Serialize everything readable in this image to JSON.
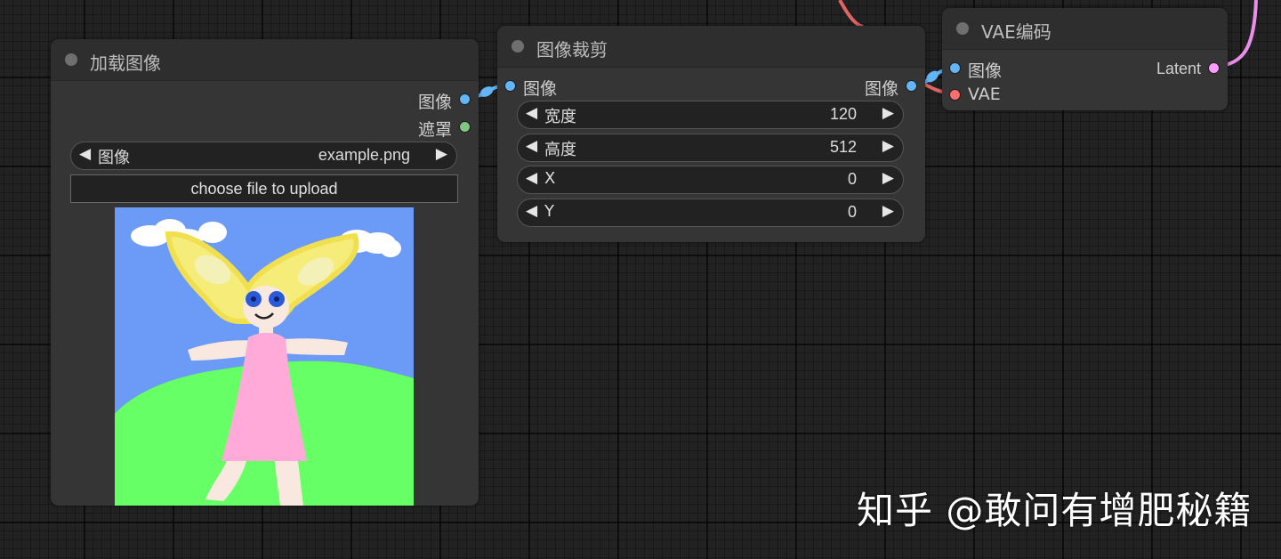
{
  "nodes": {
    "load_image": {
      "title": "加载图像",
      "outputs": [
        "图像",
        "遮罩"
      ],
      "image_widget": {
        "label": "图像",
        "value": "example.png"
      },
      "upload_label": "choose file to upload"
    },
    "crop_image": {
      "title": "图像裁剪",
      "input": "图像",
      "output": "图像",
      "widgets": [
        {
          "label": "宽度",
          "value": "120"
        },
        {
          "label": "高度",
          "value": "512"
        },
        {
          "label": "X",
          "value": "0"
        },
        {
          "label": "Y",
          "value": "0"
        }
      ]
    },
    "vae_encode": {
      "title": "VAE编码",
      "inputs": [
        "图像",
        "VAE"
      ],
      "output": "Latent"
    }
  },
  "colors": {
    "image_slot": "#64b5f6",
    "mask_slot": "#81c784",
    "vae_slot": "#ff6e6e",
    "latent_slot": "#ff9cf9",
    "vae_wire": "#e06464",
    "latent_wire": "#e98ee9",
    "image_wire": "#64b5f6"
  },
  "watermark": "知乎 @敢问有增肥秘籍"
}
